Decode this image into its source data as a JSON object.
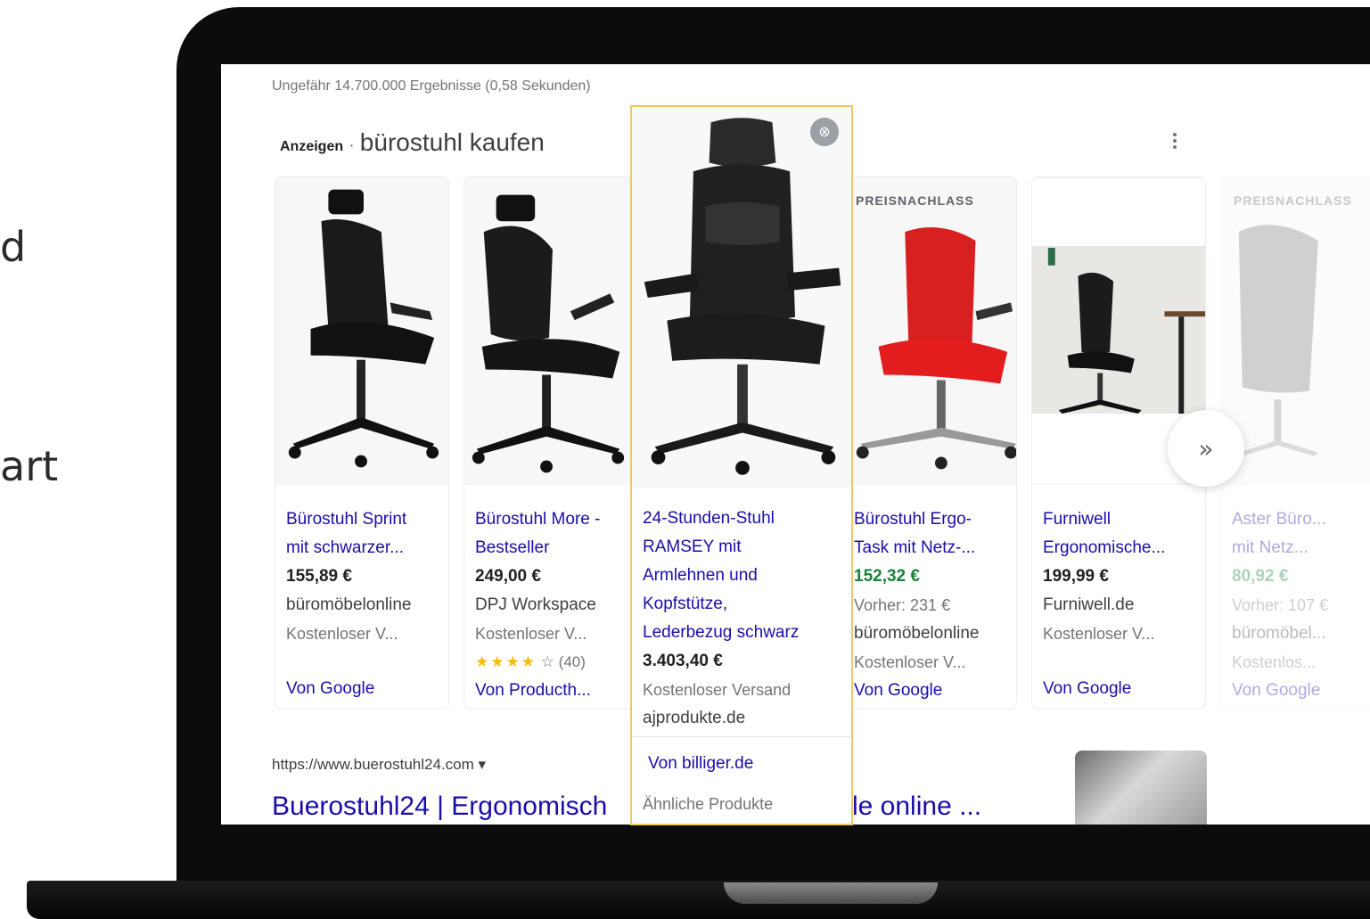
{
  "side_text": [
    "d",
    "art"
  ],
  "serp": {
    "result_stats": "Ungefähr 14.700.000 Ergebnisse (0,58 Sekunden)",
    "ads_label": "Anzeigen",
    "ads_separator": "·",
    "ads_query": "bürostuhl kaufen",
    "next_icon": "»"
  },
  "products": [
    {
      "title1": "Bürostuhl Sprint",
      "title2": "mit schwarzer...",
      "price": "155,89 €",
      "store": "büromöbelonline",
      "shipping": "Kostenloser V...",
      "source": "Von Google"
    },
    {
      "title1": "Bürostuhl More -",
      "title2": "Bestseller",
      "price": "249,00 €",
      "store": "DPJ Workspace",
      "shipping": "Kostenloser V...",
      "stars": "★★★★",
      "rating_count": "☆ (40)",
      "source": "Von Producth..."
    },
    {
      "badge": "PREISNACHLASS",
      "title1": "Bürostuhl Ergo-",
      "title2": "Task mit Netz-...",
      "price": "152,32 €",
      "was": "Vorher: 231 €",
      "store": "büromöbelonline",
      "shipping": "Kostenloser V...",
      "source": "Von Google"
    },
    {
      "title1": "Furniwell",
      "title2": "Ergonomische...",
      "price": "199,99 €",
      "store": "Furniwell.de",
      "shipping": "Kostenloser V...",
      "source": "Von Google"
    },
    {
      "badge": "PREISNACHLASS",
      "title1": "Aster Büro...",
      "title2": "mit Netz...",
      "price": "80,92 €",
      "was": "Vorher: 107 €",
      "store": "büromöbel...",
      "shipping": "Kostenlos...",
      "source": "Von Google"
    }
  ],
  "featured": {
    "title_lines": [
      "24-Stunden-Stuhl",
      "RAMSEY mit",
      "Armlehnen und",
      "Kopfstütze,",
      "Lederbezug schwarz"
    ],
    "price": "3.403,40 €",
    "shipping": "Kostenloser Versand",
    "store": "ajprodukte.de",
    "source": "Von billiger.de",
    "similar": "Ähnliche Produkte",
    "close_icon": "⊗"
  },
  "organic": {
    "url": "https://www.buerostuhl24.com  ▾",
    "title_left": "Buerostuhl24 | Ergonomisch",
    "title_right": "le online ..."
  },
  "colors": {
    "link": "#1a0dab",
    "price_sale": "#188038",
    "highlight_border": "#f3c661",
    "star": "#fbbc04"
  }
}
